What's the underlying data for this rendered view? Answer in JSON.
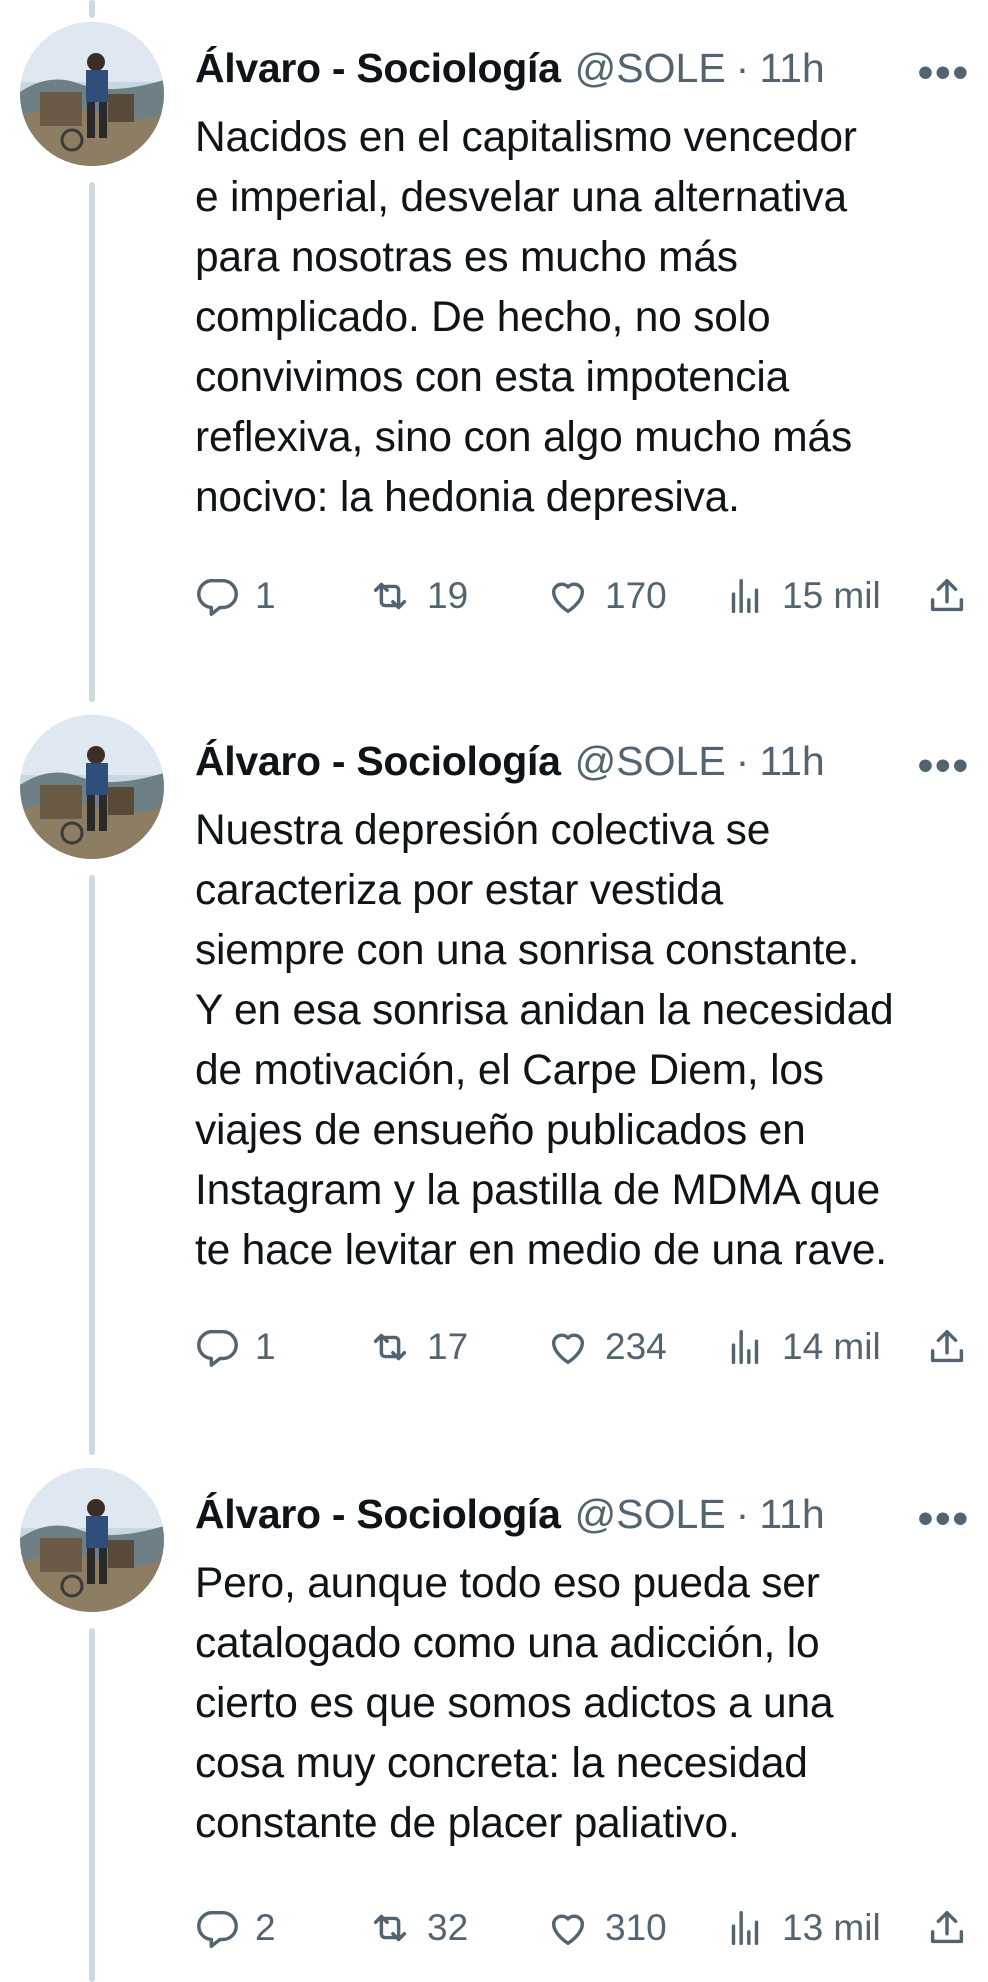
{
  "tweets": [
    {
      "author_name": "Álvaro - Sociología",
      "handle": "@SOLE",
      "separator": "·",
      "time": "11h",
      "more": "•••",
      "text": "Nacidos en el capitalismo vencedor\ne imperial, desvelar una alternativa\npara nosotras es mucho más\ncomplicado. De hecho, no solo\nconvivimos con esta impotencia\nreflexiva, sino con algo mucho más\nnocivo: la hedonia depresiva.",
      "replies": "1",
      "retweets": "19",
      "likes": "170",
      "views": "15 mil"
    },
    {
      "author_name": "Álvaro - Sociología",
      "handle": "@SOLE",
      "separator": "·",
      "time": "11h",
      "more": "•••",
      "text": "Nuestra depresión colectiva se\ncaracteriza por estar vestida\nsiempre con una sonrisa constante.\nY en esa sonrisa anidan la necesidad\nde motivación, el Carpe Diem, los\nviajes de ensueño publicados en\nInstagram y la pastilla de MDMA que\nte hace levitar en medio de una rave.",
      "replies": "1",
      "retweets": "17",
      "likes": "234",
      "views": "14 mil"
    },
    {
      "author_name": "Álvaro - Sociología",
      "handle": "@SOLE",
      "separator": "·",
      "time": "11h",
      "more": "•••",
      "text": "Pero, aunque todo eso pueda ser\ncatalogado como una adicción, lo\ncierto es que somos adictos a una\ncosa muy concreta: la necesidad\nconstante de placer paliativo.",
      "replies": "2",
      "retweets": "32",
      "likes": "310",
      "views": "13 mil"
    }
  ],
  "colors": {
    "text": "#0f1419",
    "secondary": "#536471",
    "thread_line": "#cfd9de"
  },
  "icons": {
    "reply": "reply-icon",
    "retweet": "retweet-icon",
    "like": "heart-icon",
    "views": "views-icon",
    "share": "share-icon"
  }
}
